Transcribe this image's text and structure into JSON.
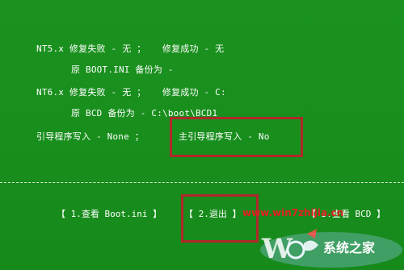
{
  "lines": {
    "nt5_status": "NT5.x 修复失败 - 无 ；   修复成功 - 无",
    "nt5_backup": "原 BOOT.INI 备份为 -",
    "nt6_status": "NT6.x 修复失败 - 无 ；   修复成功 - C:",
    "nt6_backup": "原 BCD 备份为 - C:\\boot\\BCD1",
    "loader_write": "引导程序写入 - None ；",
    "main_loader_write": "主引导程序写入 - No"
  },
  "menu": {
    "view_boot_ini": "【 1.查看 Boot.ini 】",
    "exit": "【 2.退出 】",
    "view_bcd": "【 3.查看 BCD 】"
  },
  "watermark": {
    "url": "www.win7zhijia.cn",
    "logo_text": "系统之家",
    "logo_letter": "W"
  },
  "colors": {
    "background": "#1a8d1f",
    "highlight_border": "#b0282a",
    "text": "#ffffff"
  }
}
